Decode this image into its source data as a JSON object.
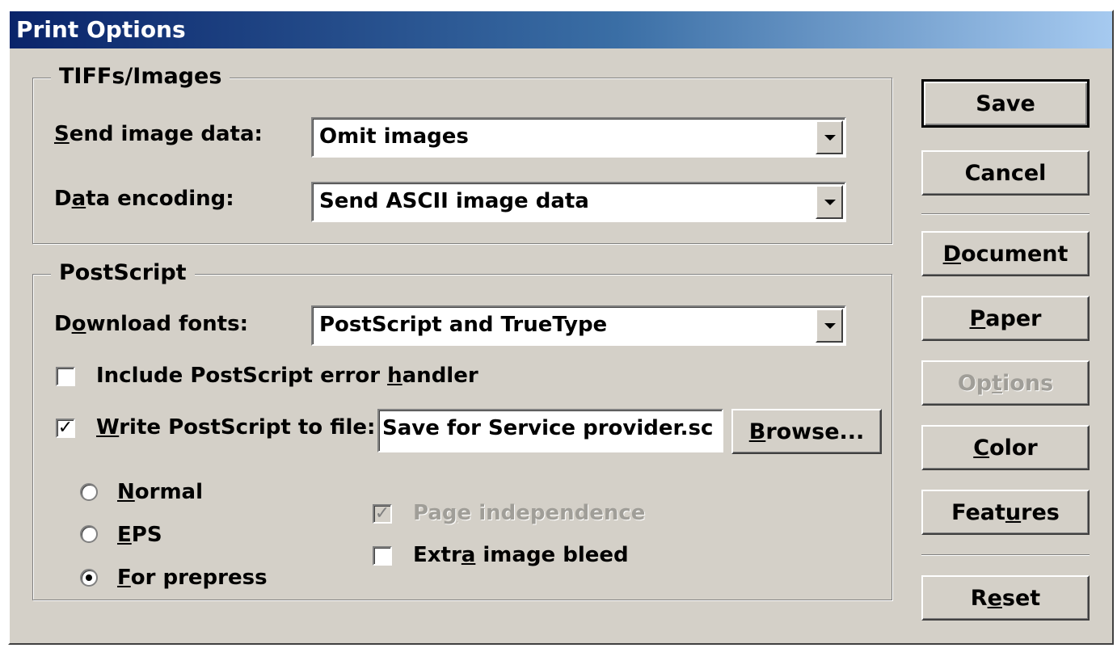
{
  "window": {
    "title": "Print Options"
  },
  "tiffs_group": {
    "legend": "TIFFs/Images",
    "send_image_data": {
      "label_u": "S",
      "label_rest": "end image data:",
      "value": "Omit images"
    },
    "data_encoding": {
      "label_pre": "D",
      "label_u": "a",
      "label_rest": "ta encoding:",
      "value": "Send ASCII image data"
    }
  },
  "postscript_group": {
    "legend": "PostScript",
    "download_fonts": {
      "label_pre": "D",
      "label_u": "o",
      "label_rest": "wnload fonts:",
      "value": "PostScript and TrueType"
    },
    "error_handler": {
      "label_pre": "Include PostScript error ",
      "label_u": "h",
      "label_rest": "andler",
      "checked": false
    },
    "write_to_file": {
      "label_u": "W",
      "label_rest": "rite PostScript to file:",
      "checked": true,
      "mark": "✓",
      "file_value": "Save for Service provider.sc"
    },
    "browse": {
      "label_u": "B",
      "label_rest": "rowse..."
    },
    "radios": {
      "normal": {
        "label_u": "N",
        "label_rest": "ormal",
        "selected": false
      },
      "eps": {
        "label_u": "E",
        "label_rest": "PS",
        "selected": false
      },
      "prepress": {
        "label_u": "F",
        "label_rest": "or prepress",
        "selected": true
      }
    },
    "page_independence": {
      "label_pre": "Pa",
      "label_u": "g",
      "label_rest": "e independence",
      "checked": true,
      "mark": "✓",
      "disabled": true
    },
    "extra_bleed": {
      "label_pre": "Extr",
      "label_u": "a",
      "label_rest": " image bleed",
      "checked": false
    }
  },
  "side_buttons": {
    "save": "Save",
    "cancel": "Cancel",
    "document": {
      "label_u": "D",
      "label_rest": "ocument"
    },
    "paper": {
      "label_u": "P",
      "label_rest": "aper"
    },
    "options": {
      "label_pre": "Op",
      "label_u": "t",
      "label_rest": "ions",
      "disabled": true
    },
    "color": {
      "label_u": "C",
      "label_rest": "olor"
    },
    "features": {
      "label_pre": "Feat",
      "label_u": "u",
      "label_rest": "res"
    },
    "reset": {
      "label_pre": "R",
      "label_u": "e",
      "label_rest": "set"
    }
  },
  "colors": {
    "face": "#d4d0c8",
    "title_start": "#0a246a",
    "title_end": "#a6caf0"
  }
}
